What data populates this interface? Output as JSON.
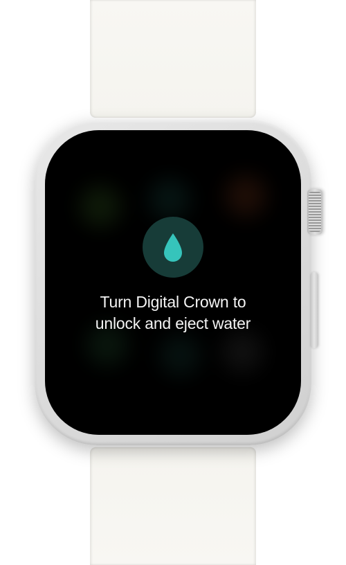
{
  "screen": {
    "instruction": "Turn Digital Crown to unlock and eject water",
    "icon_name": "water-drop",
    "icon_color": "#36c4bb",
    "icon_bg_color": "#173c38"
  }
}
